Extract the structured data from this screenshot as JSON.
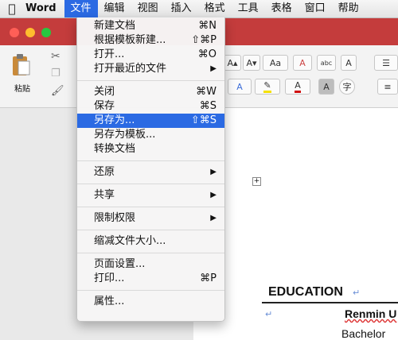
{
  "menubar": {
    "app_name": "Word",
    "items": [
      "文件",
      "编辑",
      "视图",
      "插入",
      "格式",
      "工具",
      "表格",
      "窗口",
      "帮助"
    ]
  },
  "ribbon": {
    "paste_label": "粘贴",
    "font_size_up": "A▴",
    "font_size_down": "A▾",
    "change_case": "Aa",
    "phonetic": "abc",
    "char_border": "A",
    "char_shade": "A",
    "enclose_char": "字"
  },
  "file_menu": {
    "groups": [
      [
        {
          "label": "新建文档",
          "shortcut": "⌘N"
        },
        {
          "label": "根据模板新建...",
          "shortcut": "⇧⌘P"
        },
        {
          "label": "打开...",
          "shortcut": "⌘O"
        },
        {
          "label": "打开最近的文件",
          "submenu": "▶"
        }
      ],
      [
        {
          "label": "关闭",
          "shortcut": "⌘W"
        },
        {
          "label": "保存",
          "shortcut": "⌘S"
        },
        {
          "label": "另存为...",
          "shortcut": "⇧⌘S",
          "highlighted": true
        },
        {
          "label": "另存为模板..."
        },
        {
          "label": "转换文档"
        }
      ],
      [
        {
          "label": "还原",
          "submenu": "▶"
        }
      ],
      [
        {
          "label": "共享",
          "submenu": "▶"
        }
      ],
      [
        {
          "label": "限制权限",
          "submenu": "▶"
        }
      ],
      [
        {
          "label": "缩减文件大小..."
        }
      ],
      [
        {
          "label": "页面设置..."
        },
        {
          "label": "打印...",
          "shortcut": "⌘P"
        }
      ],
      [
        {
          "label": "属性..."
        }
      ]
    ]
  },
  "document": {
    "heading": "EDUCATION",
    "line1": "Renmin U",
    "line2": "Bachelor",
    "para_mark": "↵"
  },
  "colors": {
    "menu_highlight": "#2b6ae3",
    "titlebar": "#c43c3c"
  }
}
